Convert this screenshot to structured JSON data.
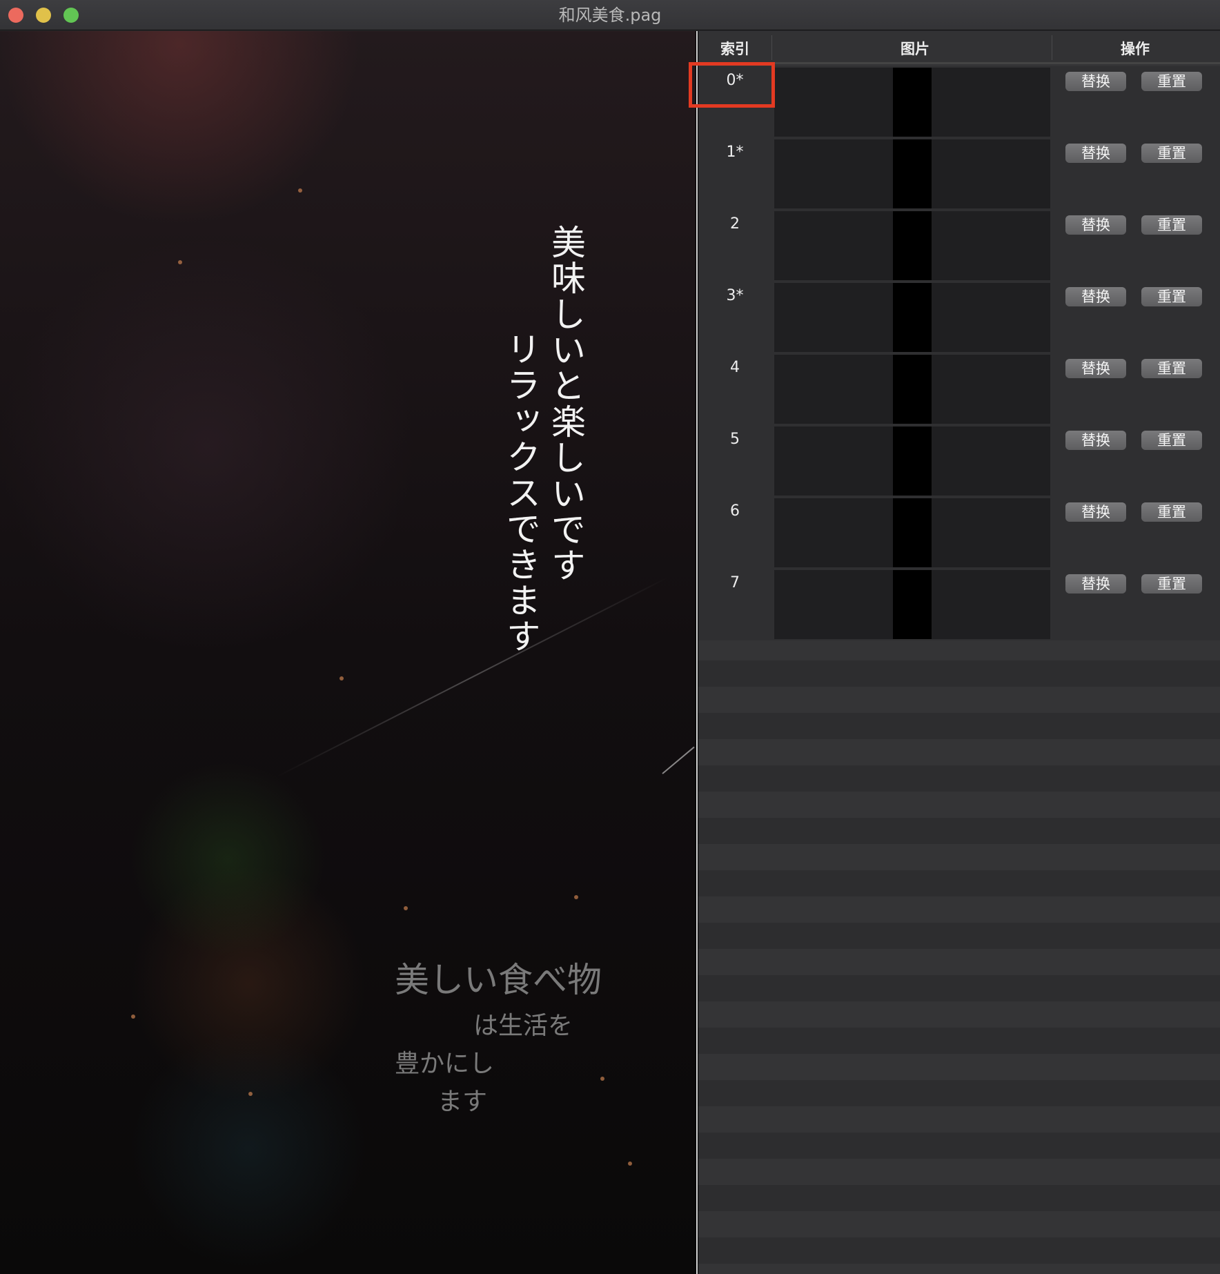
{
  "window": {
    "title": "和风美食.pag",
    "traffic_lights": {
      "close": "#ec6a5e",
      "minimize": "#e0c14a",
      "zoom": "#62c554"
    }
  },
  "preview": {
    "vertical_lines": [
      "美味しいと楽しいです",
      "リラックスできます"
    ],
    "horizontal_lines": [
      "美しい食べ物",
      "は生活を",
      "豊かにし",
      "ます"
    ]
  },
  "table": {
    "headers": [
      "索引",
      "图片",
      "操作"
    ],
    "rows": [
      {
        "index": "0*"
      },
      {
        "index": "1*"
      },
      {
        "index": "2"
      },
      {
        "index": "3*"
      },
      {
        "index": "4"
      },
      {
        "index": "5"
      },
      {
        "index": "6"
      },
      {
        "index": "7"
      }
    ],
    "replace_label": "替换",
    "reset_label": "重置",
    "highlight_color": "#e33a22"
  }
}
